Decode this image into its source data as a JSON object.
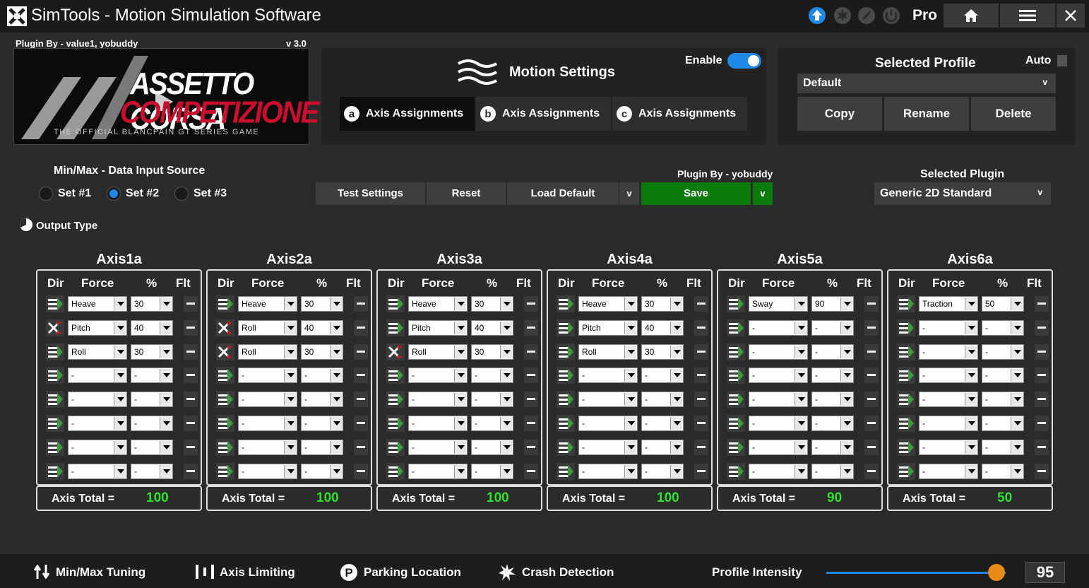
{
  "app": {
    "title": "SimTools - Motion Simulation Software",
    "pro_label": "Pro"
  },
  "game_panel": {
    "plugin_by": "Plugin By - value1, yobuddy",
    "version": "v 3.0",
    "logo_text_1": "ASSETTO CORSA",
    "logo_text_2": "COMPETIZIONE",
    "logo_sub": "THE OFFICIAL BLANCPAIN GT SERIES GAME"
  },
  "motion_settings": {
    "title": "Motion Settings",
    "enable_label": "Enable",
    "enable_on": true,
    "tabs": [
      {
        "letter": "a",
        "label": "Axis Assignments"
      },
      {
        "letter": "b",
        "label": "Axis Assignments"
      },
      {
        "letter": "c",
        "label": "Axis Assignments"
      }
    ]
  },
  "profile": {
    "title": "Selected Profile",
    "auto_label": "Auto",
    "selected": "Default",
    "buttons": [
      "Copy",
      "Rename",
      "Delete"
    ]
  },
  "data_source": {
    "label": "Min/Max - Data Input Source",
    "options": [
      "Set #1",
      "Set #2",
      "Set #3"
    ],
    "selected_index": 1
  },
  "toolbar": {
    "test_settings": "Test Settings",
    "reset": "Reset",
    "load_default": "Load Default",
    "v1": "v",
    "save_plugin_by": "Plugin By - yobuddy",
    "save": "Save",
    "v2": "v"
  },
  "plugin": {
    "label": "Selected Plugin",
    "selected": "Generic 2D Standard"
  },
  "output_type_label": "Output Type",
  "column_headers": {
    "dir": "Dir",
    "force": "Force",
    "pct": "%",
    "flt": "Flt"
  },
  "axis_total_label": "Axis Total =",
  "axes": [
    {
      "name": "Axis1a",
      "total": "100",
      "rows": [
        {
          "dir": "normal",
          "force": "Heave",
          "pct": "30"
        },
        {
          "dir": "inverted",
          "force": "Pitch",
          "pct": "40"
        },
        {
          "dir": "normal",
          "force": "Roll",
          "pct": "30"
        },
        {
          "dir": "normal",
          "force": "-",
          "pct": "-"
        },
        {
          "dir": "normal",
          "force": "-",
          "pct": "-"
        },
        {
          "dir": "normal",
          "force": "-",
          "pct": "-"
        },
        {
          "dir": "normal",
          "force": "-",
          "pct": "-"
        },
        {
          "dir": "normal",
          "force": "-",
          "pct": "-"
        }
      ]
    },
    {
      "name": "Axis2a",
      "total": "100",
      "rows": [
        {
          "dir": "normal",
          "force": "Heave",
          "pct": "30"
        },
        {
          "dir": "inverted",
          "force": "Roll",
          "pct": "40"
        },
        {
          "dir": "inverted",
          "force": "Roll",
          "pct": "30"
        },
        {
          "dir": "normal",
          "force": "-",
          "pct": "-"
        },
        {
          "dir": "normal",
          "force": "-",
          "pct": "-"
        },
        {
          "dir": "normal",
          "force": "-",
          "pct": "-"
        },
        {
          "dir": "normal",
          "force": "-",
          "pct": "-"
        },
        {
          "dir": "normal",
          "force": "-",
          "pct": "-"
        }
      ]
    },
    {
      "name": "Axis3a",
      "total": "100",
      "rows": [
        {
          "dir": "normal",
          "force": "Heave",
          "pct": "30"
        },
        {
          "dir": "normal",
          "force": "Pitch",
          "pct": "40"
        },
        {
          "dir": "inverted",
          "force": "Roll",
          "pct": "30"
        },
        {
          "dir": "normal",
          "force": "-",
          "pct": "-"
        },
        {
          "dir": "normal",
          "force": "-",
          "pct": "-"
        },
        {
          "dir": "normal",
          "force": "-",
          "pct": "-"
        },
        {
          "dir": "normal",
          "force": "-",
          "pct": "-"
        },
        {
          "dir": "normal",
          "force": "-",
          "pct": "-"
        }
      ]
    },
    {
      "name": "Axis4a",
      "total": "100",
      "rows": [
        {
          "dir": "normal",
          "force": "Heave",
          "pct": "30"
        },
        {
          "dir": "normal",
          "force": "Pitch",
          "pct": "40"
        },
        {
          "dir": "normal",
          "force": "Roll",
          "pct": "30"
        },
        {
          "dir": "normal",
          "force": "-",
          "pct": "-"
        },
        {
          "dir": "normal",
          "force": "-",
          "pct": "-"
        },
        {
          "dir": "normal",
          "force": "-",
          "pct": "-"
        },
        {
          "dir": "normal",
          "force": "-",
          "pct": "-"
        },
        {
          "dir": "normal",
          "force": "-",
          "pct": "-"
        }
      ]
    },
    {
      "name": "Axis5a",
      "total": "90",
      "rows": [
        {
          "dir": "normal",
          "force": "Sway",
          "pct": "90"
        },
        {
          "dir": "normal",
          "force": "-",
          "pct": "-"
        },
        {
          "dir": "normal",
          "force": "-",
          "pct": "-"
        },
        {
          "dir": "normal",
          "force": "-",
          "pct": "-"
        },
        {
          "dir": "normal",
          "force": "-",
          "pct": "-"
        },
        {
          "dir": "normal",
          "force": "-",
          "pct": "-"
        },
        {
          "dir": "normal",
          "force": "-",
          "pct": "-"
        },
        {
          "dir": "normal",
          "force": "-",
          "pct": "-"
        }
      ]
    },
    {
      "name": "Axis6a",
      "total": "50",
      "rows": [
        {
          "dir": "normal",
          "force": "Traction",
          "pct": "50"
        },
        {
          "dir": "normal",
          "force": "-",
          "pct": "-"
        },
        {
          "dir": "normal",
          "force": "-",
          "pct": "-"
        },
        {
          "dir": "normal",
          "force": "-",
          "pct": "-"
        },
        {
          "dir": "normal",
          "force": "-",
          "pct": "-"
        },
        {
          "dir": "normal",
          "force": "-",
          "pct": "-"
        },
        {
          "dir": "normal",
          "force": "-",
          "pct": "-"
        },
        {
          "dir": "normal",
          "force": "-",
          "pct": "-"
        }
      ]
    }
  ],
  "bottom": {
    "minmax": "Min/Max Tuning",
    "axis_limiting": "Axis Limiting",
    "parking": "Parking Location",
    "crash": "Crash Detection",
    "intensity_label": "Profile Intensity",
    "intensity_value": "95",
    "intensity_fraction": 0.95
  },
  "colors": {
    "accent_blue": "#1e88e5",
    "save_green": "#0a7a0a",
    "total_green": "#2fe02f",
    "dir_green": "#3f9a3f",
    "dir_red": "#b02222",
    "slider_orange": "#e88b16"
  }
}
